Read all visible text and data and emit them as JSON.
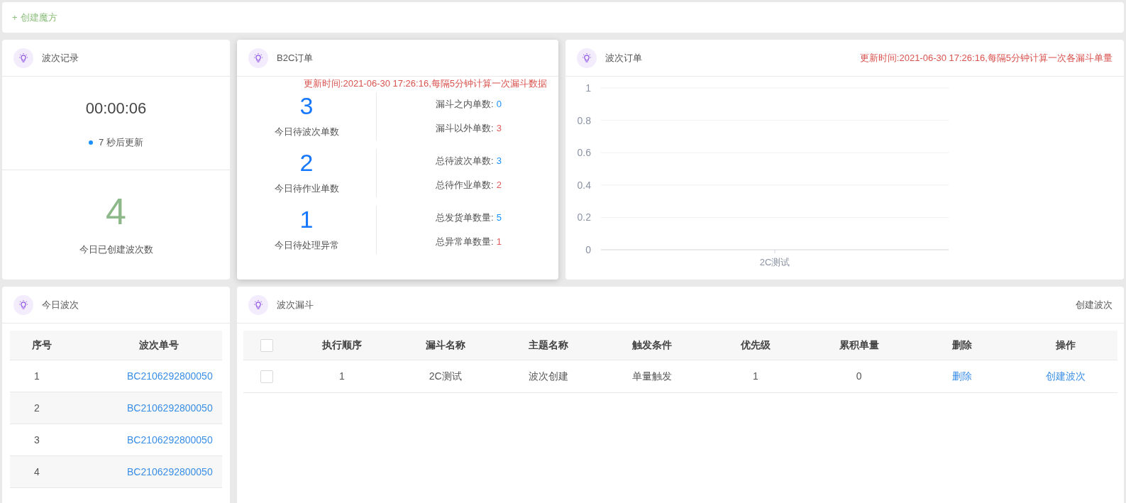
{
  "toolbar": {
    "create_label": "创建魔方",
    "create_icon": "+"
  },
  "wave_record": {
    "title": "波次记录",
    "timer": "00:00:06",
    "refresh": "7 秒后更新",
    "count": "4",
    "count_label": "今日已创建波次数"
  },
  "b2c_orders": {
    "title": "B2C订单",
    "notice": "更新时间:2021-06-30 17:26:16,每隔5分钟计算一次漏斗数据",
    "groups": [
      {
        "number": "3",
        "label": "今日待波次单数",
        "stats": [
          {
            "label": "漏斗之内单数:",
            "value": "0",
            "kind": "info"
          },
          {
            "label": "漏斗以外单数:",
            "value": "3",
            "kind": "alert"
          }
        ]
      },
      {
        "number": "2",
        "label": "今日待作业单数",
        "stats": [
          {
            "label": "总待波次单数:",
            "value": "3",
            "kind": "info"
          },
          {
            "label": "总待作业单数:",
            "value": "2",
            "kind": "alert"
          }
        ]
      },
      {
        "number": "1",
        "label": "今日待处理异常",
        "stats": [
          {
            "label": "总发货单数量:",
            "value": "5",
            "kind": "info"
          },
          {
            "label": "总异常单数量:",
            "value": "1",
            "kind": "alert"
          }
        ]
      }
    ]
  },
  "wave_orders": {
    "title": "波次订单",
    "notice": "更新时间:2021-06-30 17:26:16,每隔5分钟计算一次各漏斗单量",
    "chart_data": {
      "type": "bar",
      "grid": true,
      "categories": [
        "2C测试"
      ],
      "values": [
        0
      ],
      "ylim": [
        0,
        1
      ],
      "yticks": [
        {
          "value": 0,
          "label": "0"
        },
        {
          "value": 0.2,
          "label": "0.2"
        },
        {
          "value": 0.4,
          "label": "0.4"
        },
        {
          "value": 0.6,
          "label": "0.6"
        },
        {
          "value": 0.8,
          "label": "0.8"
        },
        {
          "value": 1,
          "label": "1"
        }
      ]
    }
  },
  "today_waves": {
    "title": "今日波次",
    "columns": [
      "序号",
      "波次单号"
    ],
    "rows": [
      {
        "index": "1",
        "wave_no": "BC2106292800050"
      },
      {
        "index": "2",
        "wave_no": "BC2106292800050"
      },
      {
        "index": "3",
        "wave_no": "BC2106292800050"
      },
      {
        "index": "4",
        "wave_no": "BC2106292800050"
      }
    ]
  },
  "wave_funnel": {
    "title": "波次漏斗",
    "action": "创建波次",
    "header_checked": false,
    "columns": [
      "执行顺序",
      "漏斗名称",
      "主题名称",
      "触发条件",
      "优先级",
      "累积单量",
      "删除",
      "操作"
    ],
    "rows": [
      {
        "checked": false,
        "cells": [
          "1",
          "2C测试",
          "波次创建",
          "单量触发",
          "1",
          "0"
        ],
        "delete": "删除",
        "operate": "创建波次"
      }
    ]
  }
}
